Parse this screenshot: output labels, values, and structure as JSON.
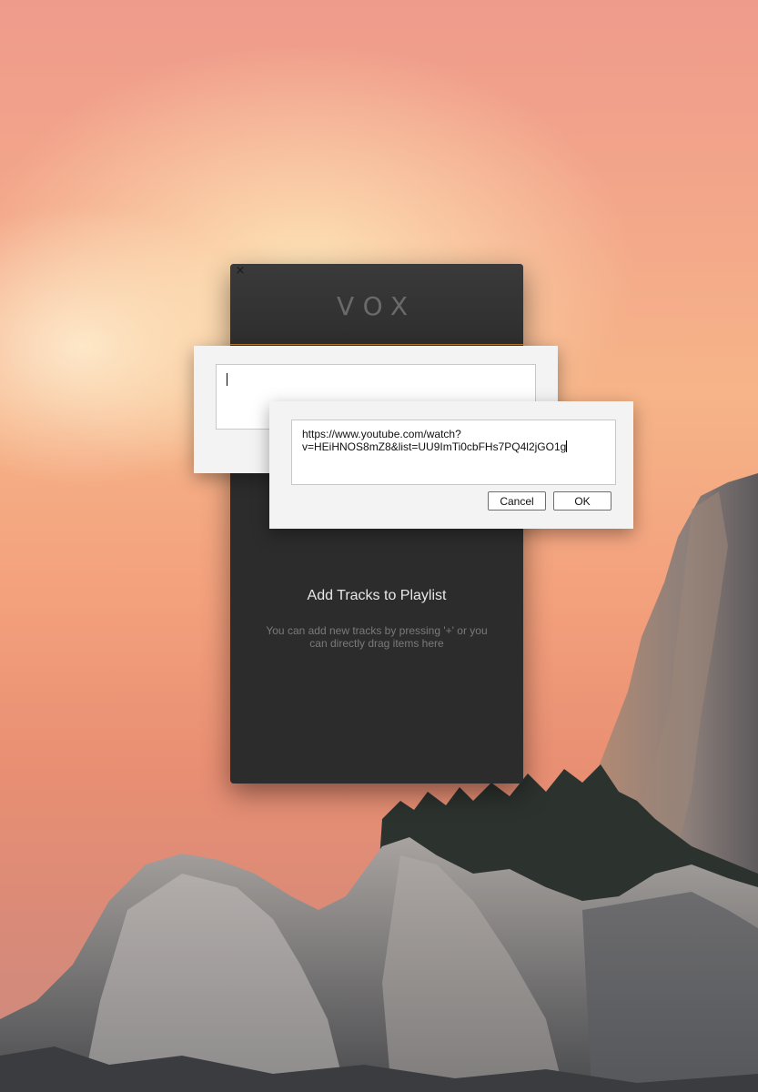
{
  "app": {
    "logo_text": "VOX",
    "close_icon": "×"
  },
  "empty_state": {
    "title": "Add Tracks to Playlist",
    "description": "You can add new tracks by pressing '+' or you can directly drag items here"
  },
  "url_dialog": {
    "url_value_line1": "https://www.youtube.com/watch?",
    "url_value_line2": "v=HEiHNOS8mZ8&list=UU9ImTi0cbFHs7PQ4l2jGO1g",
    "cancel_label": "Cancel",
    "ok_label": "OK"
  },
  "colors": {
    "window_bg": "#2c2c2c",
    "accent_line": "#c77b2a",
    "dialog_bg": "#f3f3f3"
  }
}
